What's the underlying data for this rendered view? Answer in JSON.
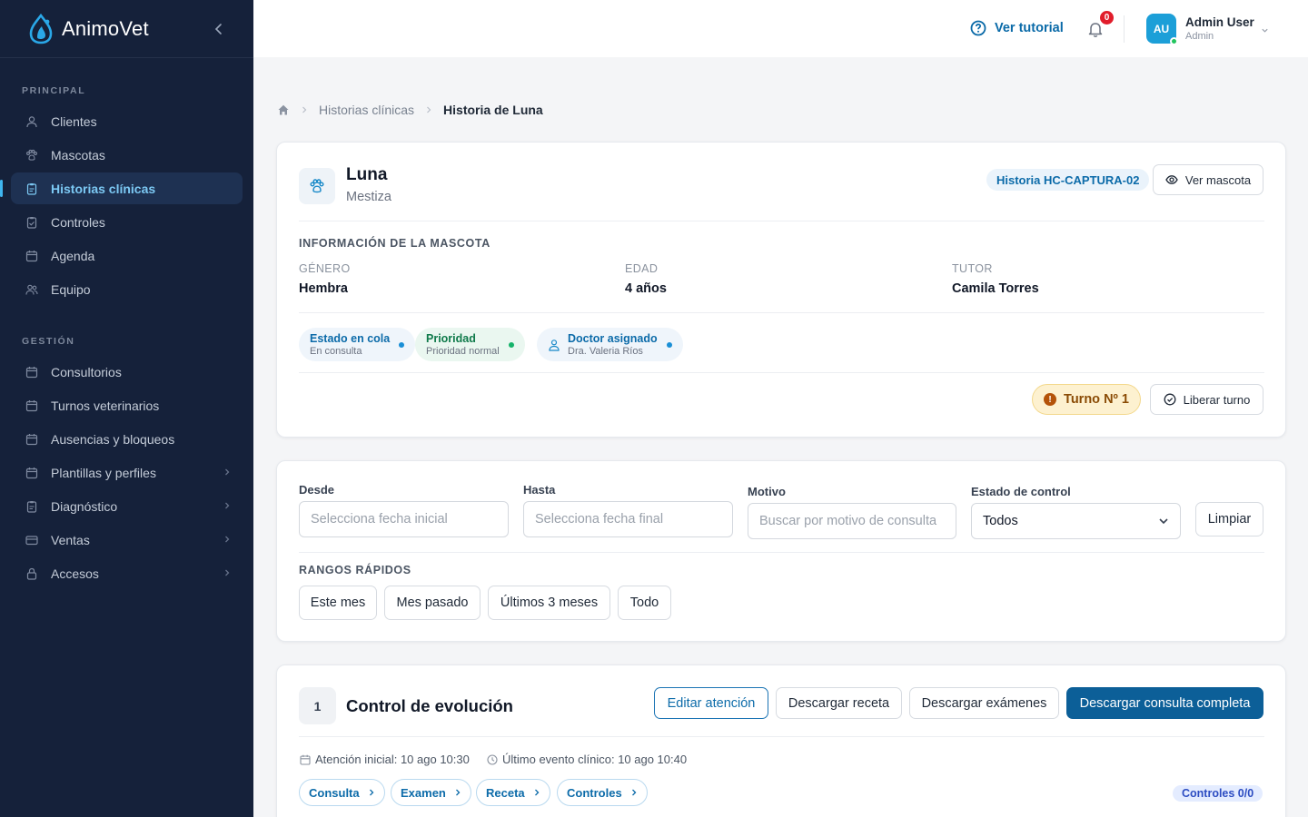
{
  "app": {
    "name": "AnimoVet"
  },
  "sidebar": {
    "sections": [
      {
        "title": "PRINCIPAL",
        "items": [
          {
            "label": "Clientes",
            "icon": "user-icon"
          },
          {
            "label": "Mascotas",
            "icon": "paw-icon"
          },
          {
            "label": "Historias clínicas",
            "icon": "clipboard-icon",
            "active": true
          },
          {
            "label": "Controles",
            "icon": "clipboard-icon"
          },
          {
            "label": "Agenda",
            "icon": "calendar-icon"
          },
          {
            "label": "Equipo",
            "icon": "users-icon"
          }
        ]
      },
      {
        "title": "GESTIÓN",
        "items": [
          {
            "label": "Consultorios",
            "icon": "calendar-icon"
          },
          {
            "label": "Turnos veterinarios",
            "icon": "calendar-icon"
          },
          {
            "label": "Ausencias y bloqueos",
            "icon": "calendar-icon"
          },
          {
            "label": "Plantillas y perfiles",
            "icon": "calendar-icon",
            "expandable": true
          },
          {
            "label": "Diagnóstico",
            "icon": "clipboard-icon",
            "expandable": true
          },
          {
            "label": "Ventas",
            "icon": "card-icon",
            "expandable": true
          },
          {
            "label": "Accesos",
            "icon": "lock-icon",
            "expandable": true
          }
        ]
      }
    ]
  },
  "topbar": {
    "tutorial_label": "Ver tutorial",
    "notifications_count": "0",
    "user": {
      "initials": "AU",
      "name": "Admin User",
      "role": "Admin"
    }
  },
  "breadcrumb": {
    "parent": "Historias clínicas",
    "current": "Historia de Luna"
  },
  "pet": {
    "name": "Luna",
    "breed": "Mestiza",
    "history_badge": "Historia HC-CAPTURA-02",
    "view_button": "Ver mascota",
    "info_title": "INFORMACIÓN DE LA MASCOTA",
    "fields": [
      {
        "label": "GÉNERO",
        "value": "Hembra"
      },
      {
        "label": "EDAD",
        "value": "4 años"
      },
      {
        "label": "TUTOR",
        "value": "Camila Torres"
      }
    ],
    "chips": [
      {
        "title": "Estado en cola",
        "sub": "En consulta"
      },
      {
        "title": "Prioridad",
        "sub": "Prioridad normal"
      },
      {
        "title": "Doctor asignado",
        "sub": "Dra. Valeria Ríos"
      }
    ],
    "turno": "Turno Nº 1",
    "release_button": "Liberar turno"
  },
  "filters": {
    "desde": {
      "label": "Desde",
      "placeholder": "Selecciona fecha inicial"
    },
    "hasta": {
      "label": "Hasta",
      "placeholder": "Selecciona fecha final"
    },
    "motivo": {
      "label": "Motivo",
      "placeholder": "Buscar por motivo de consulta"
    },
    "estado": {
      "label": "Estado de control",
      "value": "Todos"
    },
    "clear_button": "Limpiar",
    "quick_title": "RANGOS RÁPIDOS",
    "quick_ranges": [
      "Este mes",
      "Mes pasado",
      "Últimos 3 meses",
      "Todo"
    ]
  },
  "record": {
    "number": "1",
    "title": "Control de evolución",
    "actions": [
      "Editar atención",
      "Descargar receta",
      "Descargar exámenes",
      "Descargar consulta completa"
    ],
    "initial_label": "Atención inicial:",
    "initial_value": "10 ago 10:30",
    "last_label": "Último evento clínico:",
    "last_value": "10 ago 10:40",
    "tabs": [
      "Consulta",
      "Examen",
      "Receta",
      "Controles"
    ],
    "controls_badge": "Controles 0/0"
  },
  "colors": {
    "sidebar_bg": "#15213a",
    "accent": "#0c5f98",
    "active_text": "#7cc9f4"
  }
}
